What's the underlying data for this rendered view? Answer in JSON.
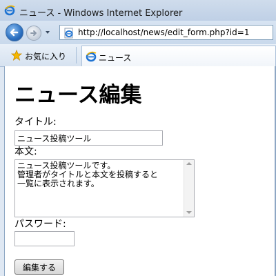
{
  "window": {
    "title": "ニュース - Windows Internet Explorer"
  },
  "navigation": {
    "address": "http://localhost/news/edit_form.php?id=1"
  },
  "tabs": {
    "favorites_label": "お気に入り",
    "active_tab_label": "ニュース"
  },
  "form": {
    "heading": "ニュース編集",
    "title_label": "タイトル:",
    "title_value": "ニュース投稿ツール",
    "body_label": "本文:",
    "body_value": "ニュース投稿ツールです。\n管理者がタイトルと本文を投稿すると\n一覧に表示されます。",
    "password_label": "パスワード:",
    "password_value": "",
    "submit_label": "編集する"
  },
  "icons": {
    "browser": "ie-icon",
    "back": "back-arrow-icon",
    "forward": "forward-arrow-icon",
    "favorites": "star-icon"
  },
  "colors": {
    "back_button": "#2a6fc0",
    "favorites_star": "#f5b800"
  }
}
